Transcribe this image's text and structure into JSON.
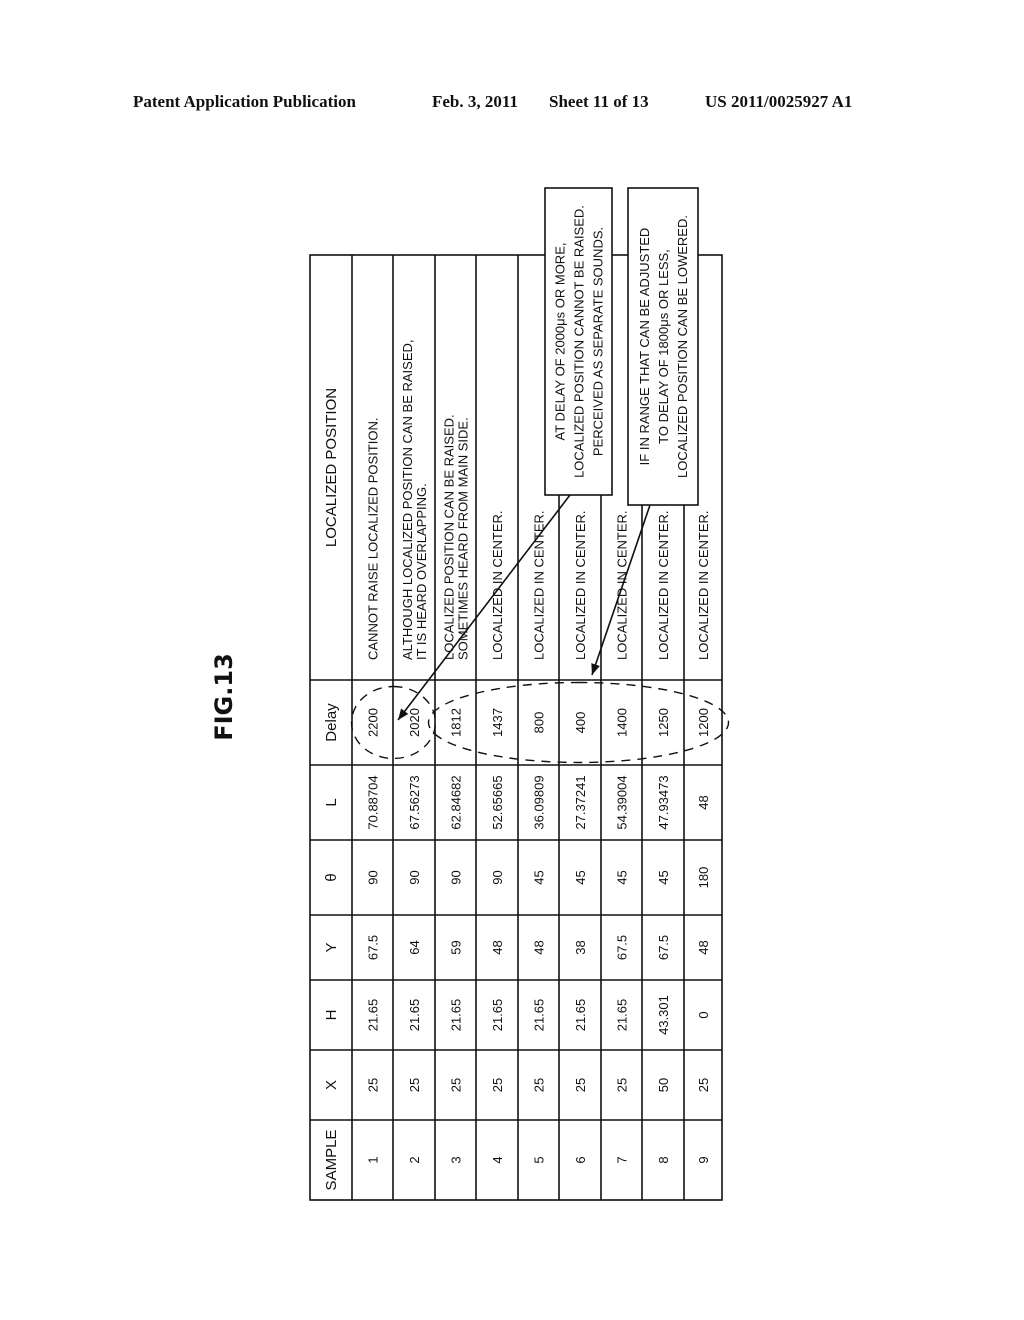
{
  "header": {
    "publication": "Patent Application Publication",
    "date": "Feb. 3, 2011",
    "sheet": "Sheet 11 of 13",
    "doc_number": "US 2011/0025927 A1"
  },
  "figure_label": "FIG.13",
  "table": {
    "columns": [
      "SAMPLE",
      "X",
      "H",
      "Y",
      "θ",
      "L",
      "Delay",
      "LOCALIZED POSITION"
    ],
    "rows": [
      {
        "sample": "1",
        "x": "25",
        "h": "21.65",
        "y": "67.5",
        "theta": "90",
        "l": "70.88704",
        "delay": "2200",
        "position": [
          "CANNOT RAISE LOCALIZED POSITION."
        ]
      },
      {
        "sample": "2",
        "x": "25",
        "h": "21.65",
        "y": "64",
        "theta": "90",
        "l": "67.56273",
        "delay": "2020",
        "position": [
          "ALTHOUGH LOCALIZED POSITION CAN BE RAISED,",
          "IT IS HEARD OVERLAPPING."
        ]
      },
      {
        "sample": "3",
        "x": "25",
        "h": "21.65",
        "y": "59",
        "theta": "90",
        "l": "62.84682",
        "delay": "1812",
        "position": [
          "LOCALIZED POSITION CAN BE RAISED.",
          "SOMETIMES HEARD FROM MAIN SIDE."
        ]
      },
      {
        "sample": "4",
        "x": "25",
        "h": "21.65",
        "y": "48",
        "theta": "90",
        "l": "52.65665",
        "delay": "1437",
        "position": [
          "LOCALIZED IN CENTER."
        ]
      },
      {
        "sample": "5",
        "x": "25",
        "h": "21.65",
        "y": "48",
        "theta": "45",
        "l": "36.09809",
        "delay": "800",
        "position": [
          "LOCALIZED IN CENTER."
        ]
      },
      {
        "sample": "6",
        "x": "25",
        "h": "21.65",
        "y": "38",
        "theta": "45",
        "l": "27.37241",
        "delay": "400",
        "position": [
          "LOCALIZED IN CENTER."
        ]
      },
      {
        "sample": "7",
        "x": "25",
        "h": "21.65",
        "y": "67.5",
        "theta": "45",
        "l": "54.39004",
        "delay": "1400",
        "position": [
          "LOCALIZED IN CENTER."
        ]
      },
      {
        "sample": "8",
        "x": "50",
        "h": "43.301",
        "y": "67.5",
        "theta": "45",
        "l": "47.93473",
        "delay": "1250",
        "position": [
          "LOCALIZED IN CENTER."
        ]
      },
      {
        "sample": "9",
        "x": "25",
        "h": "0",
        "y": "48",
        "theta": "180",
        "l": "48",
        "delay": "1200",
        "position": [
          "LOCALIZED IN CENTER."
        ]
      }
    ]
  },
  "callouts": [
    {
      "lines": [
        "AT DELAY OF 2000μs OR MORE,",
        "LOCALIZED POSITION CANNOT BE RAISED.",
        "PERCEIVED AS SEPARATE SOUNDS."
      ],
      "points_to_samples": [
        "1",
        "2"
      ]
    },
    {
      "lines": [
        "IF IN RANGE THAT CAN BE ADJUSTED",
        "TO DELAY OF 1800μs OR LESS,",
        "LOCALIZED POSITION CAN BE LOWERED."
      ],
      "points_to_samples": [
        "3",
        "4",
        "5",
        "6",
        "7",
        "8",
        "9"
      ]
    }
  ]
}
